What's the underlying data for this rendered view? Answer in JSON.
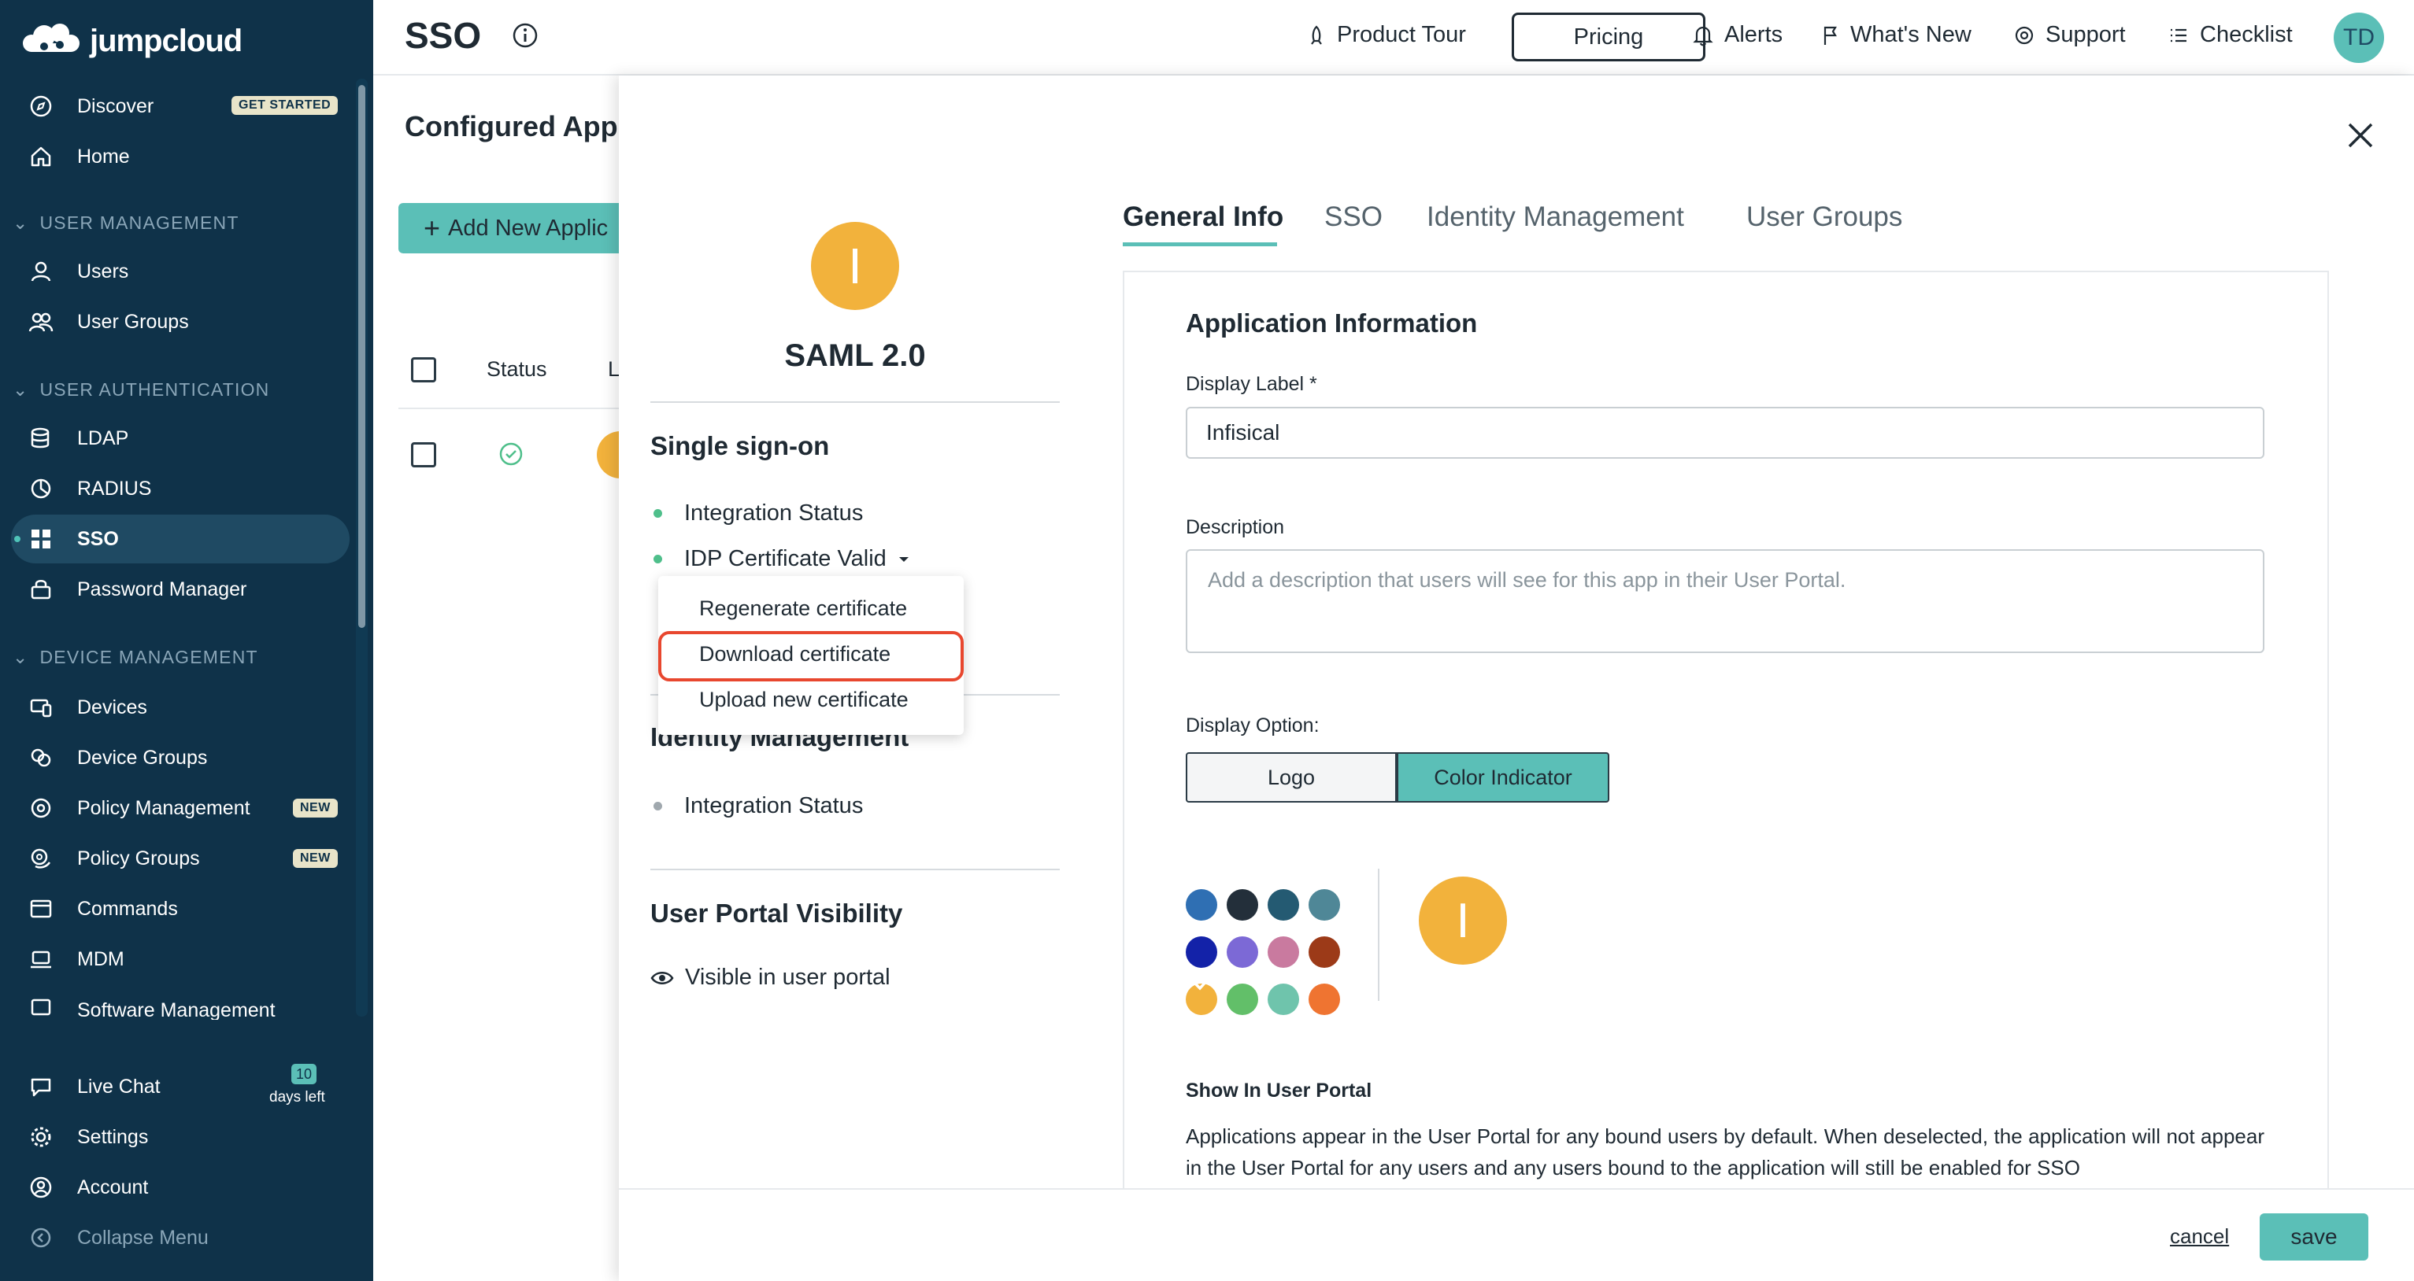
{
  "sidebar": {
    "brand": "jumpcloud",
    "discover": "Discover",
    "get_started": "GET STARTED",
    "home": "Home",
    "sec_user_mgmt": "USER MANAGEMENT",
    "users": "Users",
    "user_groups": "User Groups",
    "sec_user_auth": "USER AUTHENTICATION",
    "ldap": "LDAP",
    "radius": "RADIUS",
    "sso": "SSO",
    "password_manager": "Password Manager",
    "sec_device_mgmt": "DEVICE MANAGEMENT",
    "devices": "Devices",
    "device_groups": "Device Groups",
    "policy_management": "Policy Management",
    "policy_groups": "Policy Groups",
    "new_badge": "NEW",
    "commands": "Commands",
    "mdm": "MDM",
    "software_management": "Software Management",
    "live_chat": "Live Chat",
    "trial_days": "10",
    "trial_label": "days left",
    "settings": "Settings",
    "account": "Account",
    "collapse": "Collapse Menu"
  },
  "topbar": {
    "title": "SSO",
    "product_tour": "Product Tour",
    "pricing": "Pricing",
    "alerts": "Alerts",
    "whats_new": "What's New",
    "support": "Support",
    "checklist": "Checklist",
    "avatar_initials": "TD"
  },
  "background": {
    "title": "Configured App",
    "add_button": "Add New Applic",
    "col_status": "Status",
    "col_l": "L"
  },
  "panel": {
    "app_initial": "I",
    "app_type": "SAML 2.0",
    "sso_heading": "Single sign-on",
    "integration_status": "Integration Status",
    "idp_cert": "IDP Certificate Valid",
    "identity_heading": "Identity Management",
    "identity_status": "Integration Status",
    "portal_heading": "User Portal Visibility",
    "portal_visible": "Visible in user portal"
  },
  "dropdown": {
    "items": [
      "Regenerate certificate",
      "Download certificate",
      "Upload new certificate"
    ]
  },
  "tabs": [
    "General Info",
    "SSO",
    "Identity Management",
    "User Groups"
  ],
  "form": {
    "heading": "Application Information",
    "display_label": "Display Label *",
    "display_value": "Infisical",
    "description_label": "Description",
    "description_placeholder": "Add a description that users will see for this app in their User Portal.",
    "display_option_label": "Display Option:",
    "option_logo": "Logo",
    "option_color": "Color Indicator",
    "preview_initial": "I",
    "show_portal_label": "Show In User Portal",
    "show_portal_text": "Applications appear in the User Portal for any bound users by default. When deselected, the application will not appear in the User Portal for any users and any users bound to the application will still be enabled for SSO"
  },
  "swatches": [
    "#2f6fb3",
    "#232f3a",
    "#245a72",
    "#4f8797",
    "#1322a8",
    "#7c69d6",
    "#c97a9f",
    "#9c3a18",
    "#f2b23c",
    "#62bf69",
    "#6fc4ac",
    "#ef7431"
  ],
  "footer": {
    "cancel": "cancel",
    "save": "save"
  }
}
